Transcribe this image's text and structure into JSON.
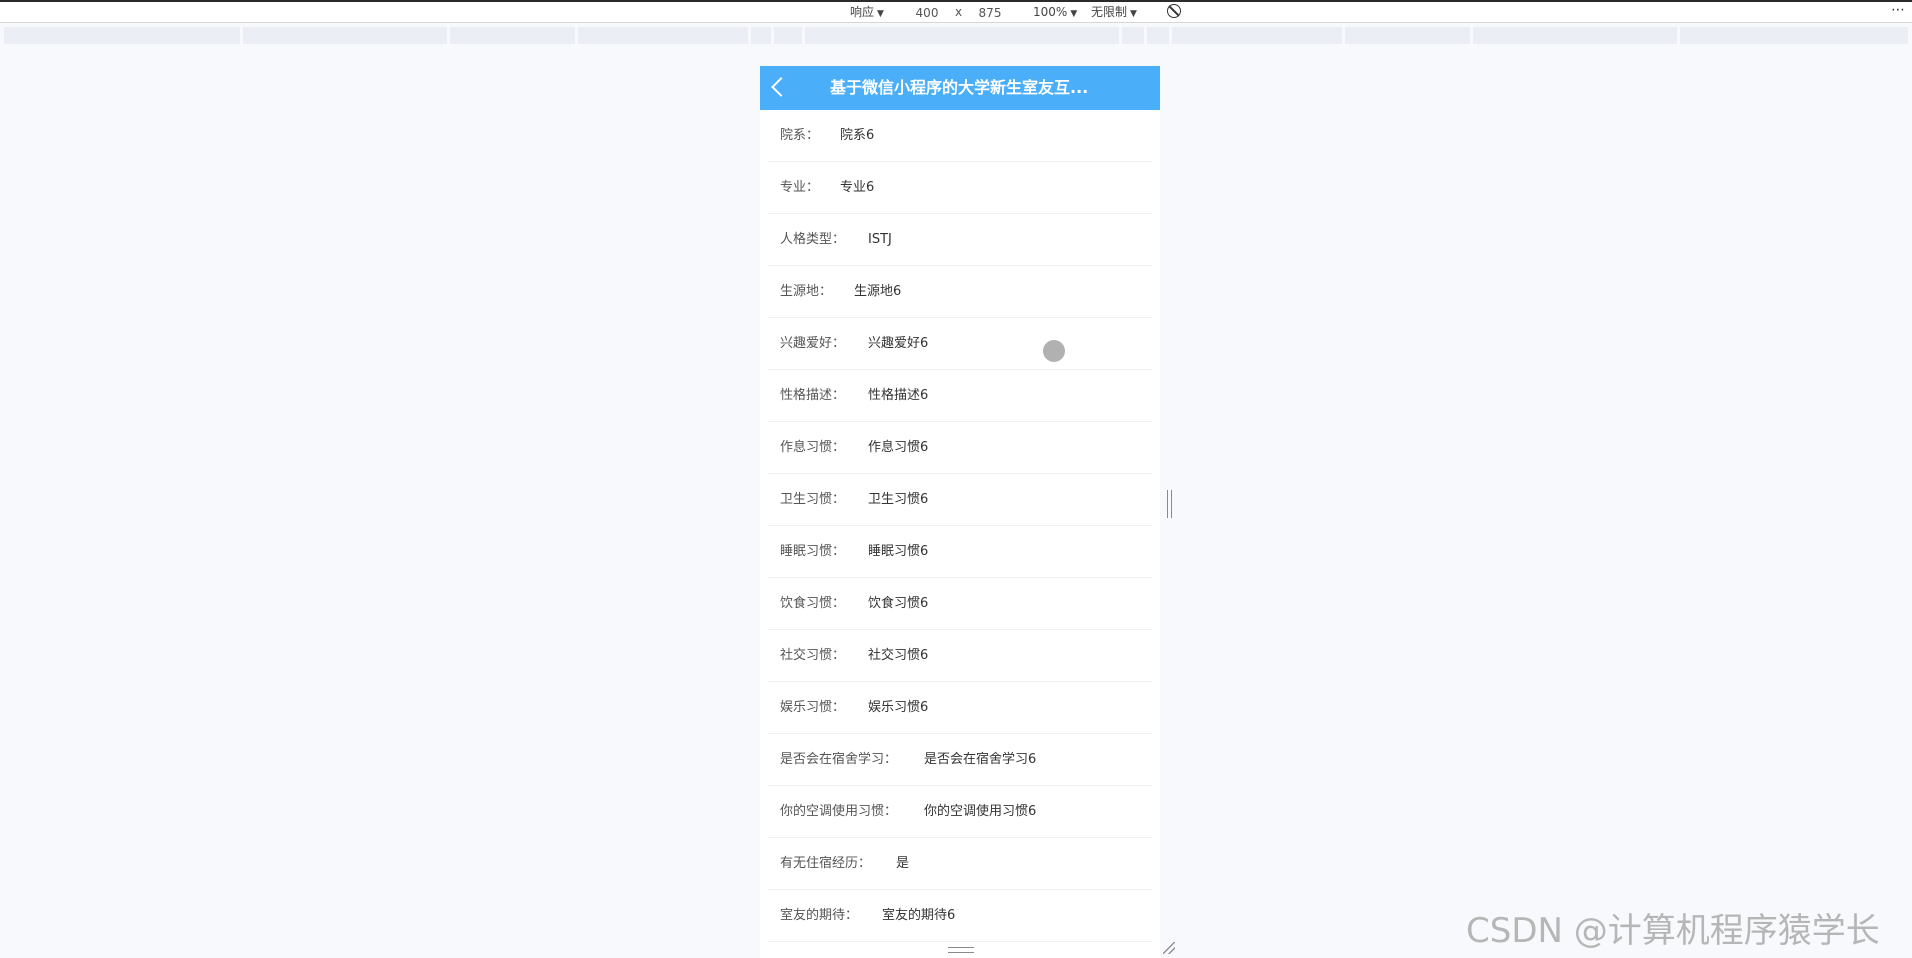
{
  "devtools": {
    "device_mode": "响应",
    "width": "400",
    "times": "x",
    "height": "875",
    "zoom": "100%",
    "throttle": "无限制",
    "rotate_icon": "no-sign-icon",
    "more_icon": "more-vertical-icon"
  },
  "header": {
    "back_icon": "chevron-left-icon",
    "title": "基于微信小程序的大学新生室友互..."
  },
  "details": {
    "rows": [
      {
        "label": "院系：",
        "value": "院系6"
      },
      {
        "label": "专业：",
        "value": "专业6"
      },
      {
        "label": "人格类型：",
        "value": "ISTJ"
      },
      {
        "label": "生源地：",
        "value": "生源地6"
      },
      {
        "label": "兴趣爱好：",
        "value": "兴趣爱好6"
      },
      {
        "label": "性格描述：",
        "value": "性格描述6"
      },
      {
        "label": "作息习惯：",
        "value": "作息习惯6"
      },
      {
        "label": "卫生习惯：",
        "value": "卫生习惯6"
      },
      {
        "label": "睡眠习惯：",
        "value": "睡眠习惯6"
      },
      {
        "label": "饮食习惯：",
        "value": "饮食习惯6"
      },
      {
        "label": "社交习惯：",
        "value": "社交习惯6"
      },
      {
        "label": "娱乐习惯：",
        "value": "娱乐习惯6"
      },
      {
        "label": "是否会在宿舍学习：",
        "value": "是否会在宿舍学习6"
      },
      {
        "label": "你的空调使用习惯：",
        "value": "你的空调使用习惯6"
      },
      {
        "label": "有无住宿经历：",
        "value": "是"
      },
      {
        "label": "室友的期待：",
        "value": "室友的期待6"
      }
    ]
  },
  "watermark": "CSDN @计算机程序猿学长"
}
